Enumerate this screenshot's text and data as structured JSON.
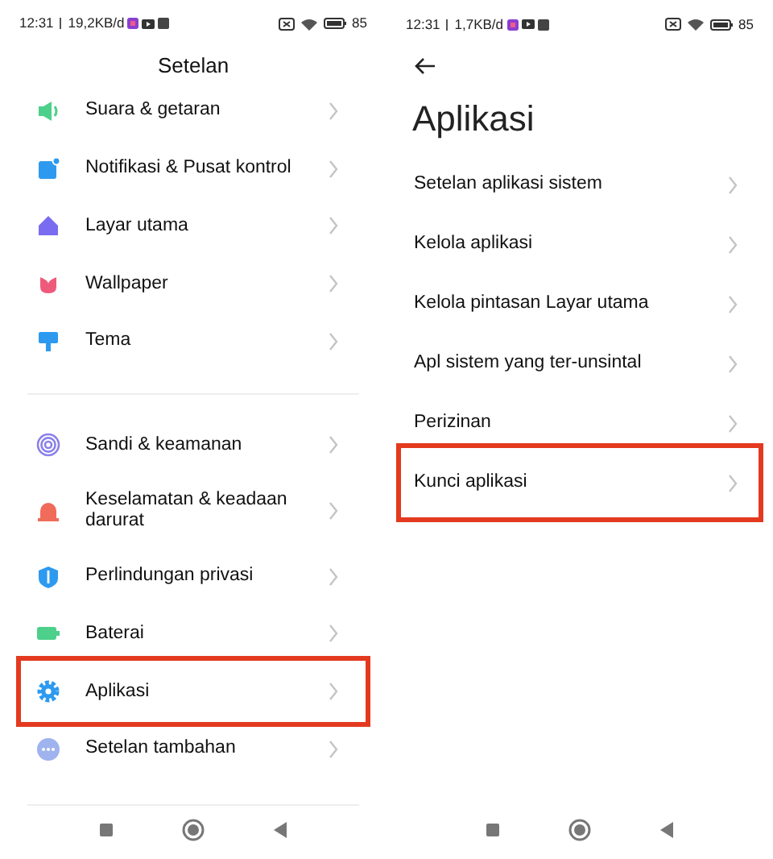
{
  "screens": [
    {
      "status_bar": {
        "time": "12:31",
        "speed": "19,2KB/d",
        "battery": "85"
      },
      "title": "Setelan",
      "groups": [
        {
          "items": [
            {
              "label": "Suara & getaran",
              "highlighted": false
            },
            {
              "label": "Notifikasi & Pusat kontrol",
              "highlighted": false
            },
            {
              "label": "Layar utama",
              "highlighted": false
            },
            {
              "label": "Wallpaper",
              "highlighted": false
            },
            {
              "label": "Tema",
              "highlighted": false
            }
          ]
        },
        {
          "items": [
            {
              "label": "Sandi & keamanan",
              "highlighted": false
            },
            {
              "label": "Keselamatan & keadaan darurat",
              "highlighted": false
            },
            {
              "label": "Perlindungan privasi",
              "highlighted": false
            },
            {
              "label": "Baterai",
              "highlighted": false
            },
            {
              "label": "Aplikasi",
              "highlighted": true
            },
            {
              "label": "Setelan tambahan",
              "highlighted": false
            }
          ]
        }
      ]
    },
    {
      "status_bar": {
        "time": "12:31",
        "speed": "1,7KB/d",
        "battery": "85"
      },
      "title": "Aplikasi",
      "items": [
        {
          "label": "Setelan aplikasi sistem",
          "highlighted": false
        },
        {
          "label": "Kelola aplikasi",
          "highlighted": false
        },
        {
          "label": "Kelola pintasan Layar utama",
          "highlighted": false
        },
        {
          "label": "Apl sistem yang ter-unsintal",
          "highlighted": false
        },
        {
          "label": "Perizinan",
          "highlighted": false
        },
        {
          "label": "Kunci aplikasi",
          "highlighted": true
        }
      ]
    }
  ]
}
